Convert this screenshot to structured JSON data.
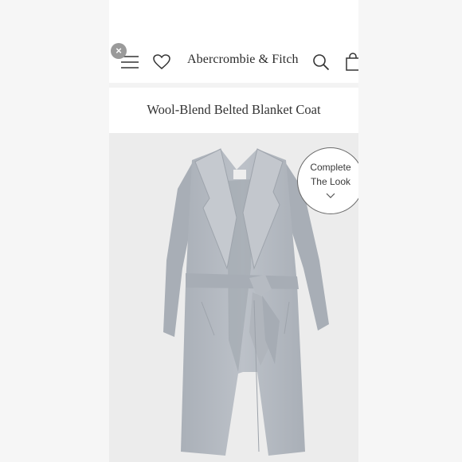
{
  "header": {
    "brand": "Abercrombie & Fitch",
    "close_glyph": "×",
    "icons": [
      "close-icon",
      "menu-icon",
      "heart-icon",
      "search-icon",
      "bag-icon"
    ]
  },
  "product": {
    "title": "Wool-Blend Belted Blanket Coat",
    "image_icon": "coat-image"
  },
  "complete_look": {
    "line1": "Complete",
    "line2": "The Look",
    "icon": "chevron-down-icon"
  },
  "colors": {
    "coat": "#b7bcc3",
    "background": "#ececec",
    "text": "#333333"
  }
}
